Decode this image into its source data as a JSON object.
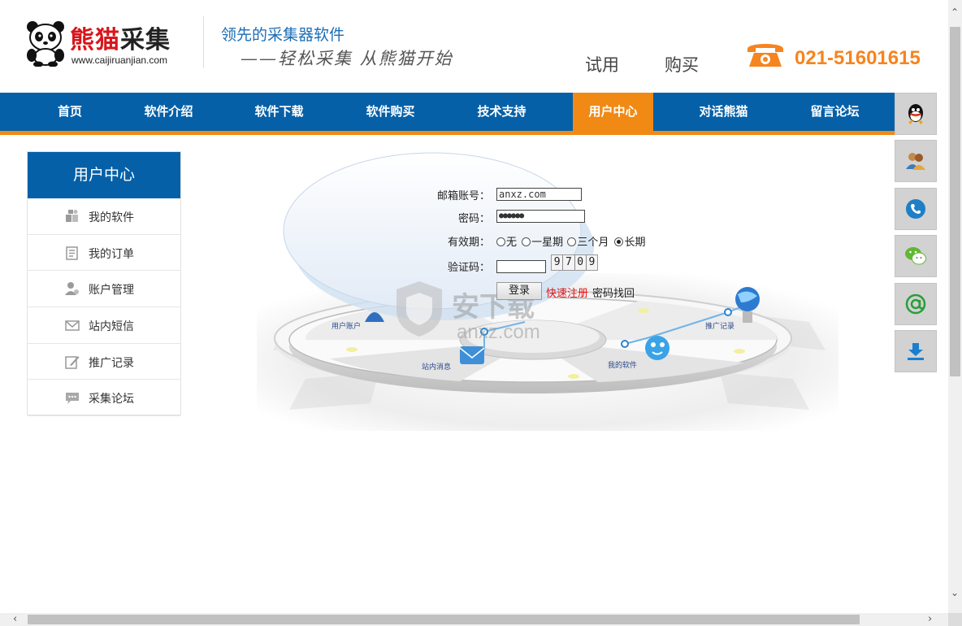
{
  "header": {
    "logo_name_1": "熊猫",
    "logo_name_2": "采集",
    "logo_url": "www.caijiruanjian.com",
    "slogan_main": "领先的采集器软件",
    "slogan_sub": "——轻松采集 从熊猫开始",
    "trial_label": "试用",
    "buy_label": "购买",
    "phone": "021-51601615"
  },
  "nav": {
    "items": [
      "首页",
      "软件介绍",
      "软件下载",
      "软件购买",
      "技术支持",
      "用户中心",
      "对话熊猫",
      "留言论坛"
    ],
    "active": "用户中心"
  },
  "sidebar": {
    "title": "用户中心",
    "items": [
      {
        "label": "我的软件",
        "icon": "puzzle-icon"
      },
      {
        "label": "我的订单",
        "icon": "order-icon"
      },
      {
        "label": "账户管理",
        "icon": "user-settings-icon"
      },
      {
        "label": "站内短信",
        "icon": "envelope-icon"
      },
      {
        "label": "推广记录",
        "icon": "edit-icon"
      },
      {
        "label": "采集论坛",
        "icon": "chat-icon"
      }
    ]
  },
  "login": {
    "email_label": "邮箱账号：",
    "email_value": "anxz.com",
    "password_label": "密码：",
    "password_value": "●●●●●●",
    "validity_label": "有效期：",
    "validity_options": [
      "无",
      "一星期",
      "三个月",
      "长期"
    ],
    "validity_selected": "长期",
    "captcha_label": "验证码：",
    "captcha_value": "",
    "captcha_digits": [
      "9",
      "7",
      "0",
      "9"
    ],
    "login_button": "登录",
    "register_link": "快速注册",
    "forgot_link": "密码找回"
  },
  "illustration": {
    "labels": [
      "用户账户",
      "站内消息",
      "我的软件",
      "推广记录"
    ]
  },
  "watermark": {
    "text": "安下载",
    "url": "anxz.com"
  },
  "float_bar": [
    "qq-icon",
    "users-icon",
    "phone-icon",
    "wechat-icon",
    "email-icon",
    "download-icon"
  ],
  "colors": {
    "nav_blue": "#0560a8",
    "accent_orange": "#f08a14",
    "logo_red": "#d8161b",
    "link_red": "#e01010"
  }
}
